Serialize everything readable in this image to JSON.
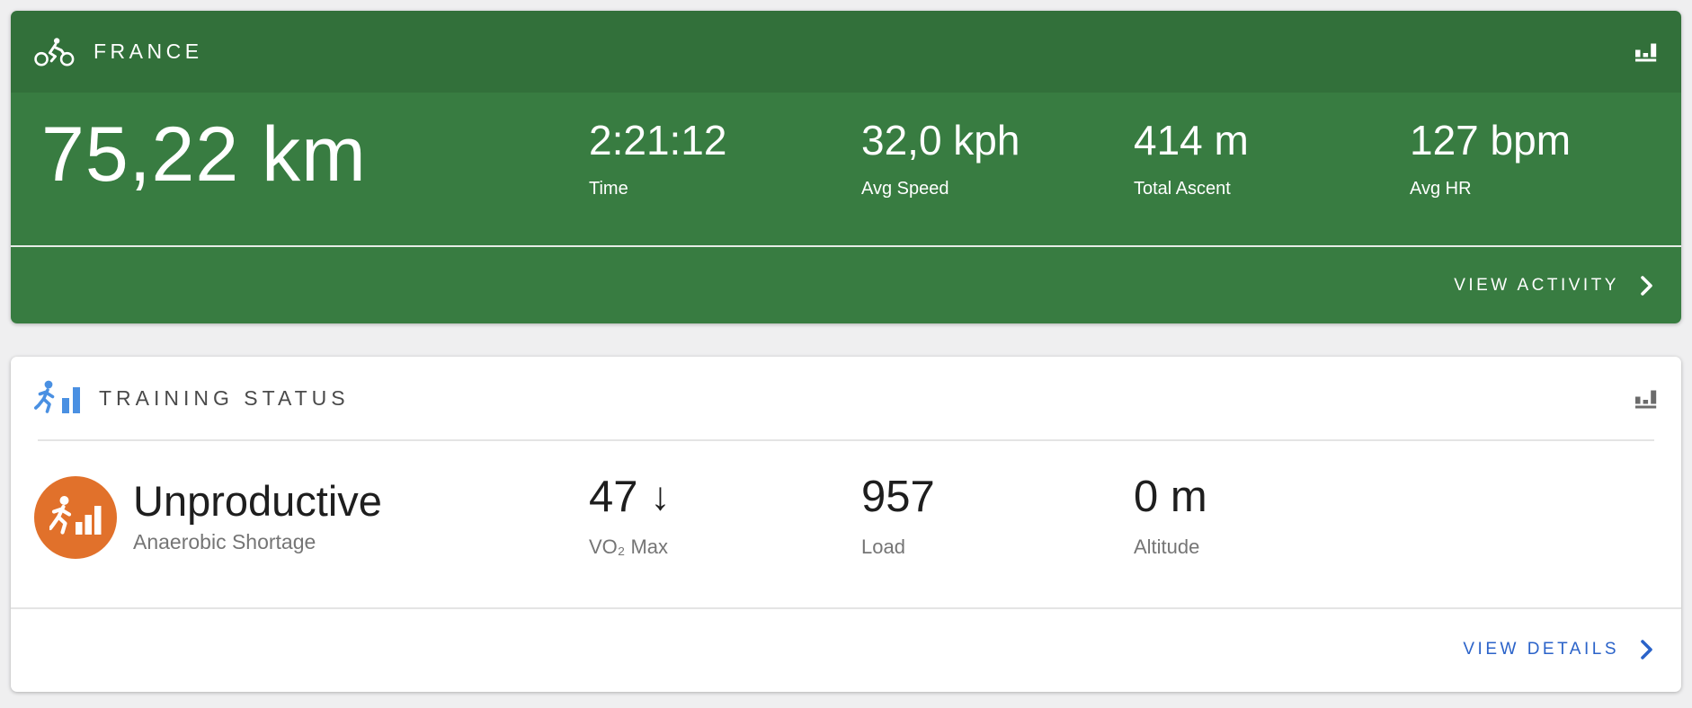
{
  "colors": {
    "page_bg": "#EFEFF0",
    "green_header": "#32703A",
    "green_body": "#387C41",
    "green_divider": "#E7ECE7",
    "white_divider": "#E4E4E4",
    "title_gray": "#4A4A4A",
    "text_dark": "#1E1E1E",
    "text_gray": "#757575",
    "link_blue": "#2B63C9",
    "icon_blue": "#4A90E2",
    "icon_gray": "#6B6B6B",
    "badge_orange": "#E1712B"
  },
  "activity_card": {
    "title": "FRANCE",
    "activity_icon": "cycling-icon",
    "chart_icon": "bar-chart-icon",
    "primary_value": "75,22 km",
    "stats": [
      {
        "value": "2:21:12",
        "label": "Time"
      },
      {
        "value": "32,0 kph",
        "label": "Avg Speed"
      },
      {
        "value": "414 m",
        "label": "Total Ascent"
      },
      {
        "value": "127 bpm",
        "label": "Avg HR"
      }
    ],
    "footer_link": "VIEW ACTIVITY"
  },
  "training_card": {
    "title": "TRAINING STATUS",
    "header_icon": "runner-chart-icon",
    "chart_icon": "bar-chart-icon",
    "status": {
      "badge_icon": "runner-chart-icon",
      "title": "Unproductive",
      "subtitle": "Anaerobic Shortage"
    },
    "stats": [
      {
        "value": "47",
        "trend": "↓",
        "label": "VO₂ Max"
      },
      {
        "value": "957",
        "trend": "",
        "label": "Load"
      },
      {
        "value": "0 m",
        "trend": "",
        "label": "Altitude"
      }
    ],
    "footer_link": "VIEW DETAILS"
  }
}
